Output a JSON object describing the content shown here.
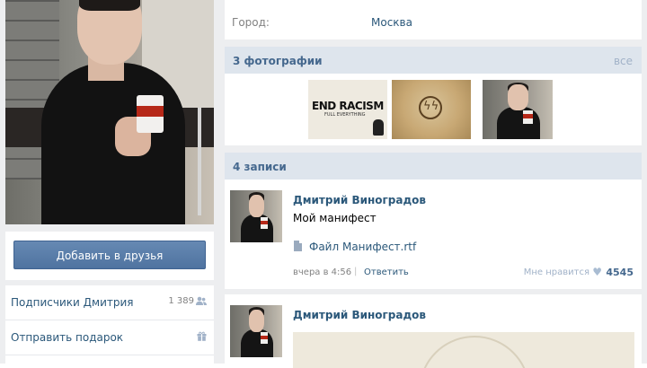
{
  "profile": {
    "add_friend_label": "Добавить в друзья",
    "followers_label": "Подписчики Дмитрия",
    "followers_count": "1 389",
    "gift_label": "Отправить подарок"
  },
  "info": {
    "city_key": "Город:",
    "city_value": "Москва"
  },
  "photos": {
    "title": "3 фотографии",
    "all_label": "все",
    "thumb1_text": "END RACISM",
    "thumb1_subtext": "FULL EVERYTHING"
  },
  "posts": {
    "title": "4 записи",
    "items": [
      {
        "author": "Дмитрий Виноградов",
        "text": "Мой манифест",
        "file": "Файл Манифест.rtf",
        "time": "вчера в 4:56",
        "sep": "|",
        "reply": "Ответить",
        "like_label": "Мне нравится",
        "likes": "4545"
      },
      {
        "author": "Дмитрий Виноградов"
      }
    ]
  },
  "colors": {
    "link": "#2b587a",
    "section_bg": "#dee5ed",
    "page_bg": "#edeef0",
    "button": "#5b7fa8"
  }
}
